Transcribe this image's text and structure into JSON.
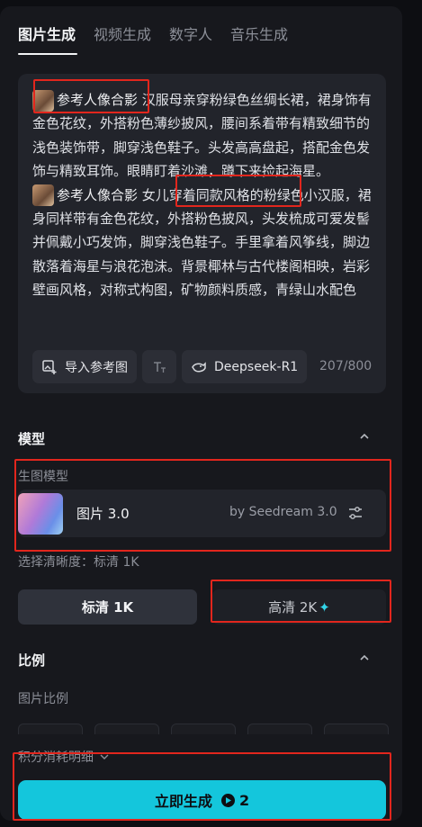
{
  "tabs": [
    {
      "label": "图片生成",
      "active": true
    },
    {
      "label": "视频生成",
      "active": false
    },
    {
      "label": "数字人",
      "active": false
    },
    {
      "label": "音乐生成",
      "active": false
    }
  ],
  "prompt": {
    "chip_label": "参考人像合影",
    "segment_1": " 汉服母亲穿粉绿色丝绸长裙，裙身饰有金色花纹，外搭粉色薄纱披风，腰间系着带有精致细节的浅色装饰带，脚穿浅色鞋子。头发高高盘起，搭配金色发饰与精致耳饰。眼睛盯着沙滩，蹲下来捡起海星。",
    "segment_2": " 女儿穿着同款风格的粉绿色小汉服，裙身同样带有金色花纹，外搭粉色披风，头发梳成可爱发髻并佩戴小巧发饰，脚穿浅色鞋子。手里拿着风筝线，脚边散落着海星与浪花泡沫。背景椰林与古代楼阁相映，岩彩壁画风格，对称式构图，矿物颜料质感，青绿山水配色"
  },
  "tools": {
    "import_ref": "导入参考图",
    "text_tool_icon": "text-format-icon",
    "deepseek": "Deepseek-R1",
    "counter": "207/800"
  },
  "model_section": {
    "title": "模型",
    "sub_label": "生图模型",
    "model_name": "图片 3.0",
    "model_by": "by Seedream 3.0",
    "resolution_label": "选择清晰度：标清 1K",
    "res_sd": "标清 1K",
    "res_hd": "高清 2K",
    "res_hd_icon": "sparkle-icon"
  },
  "ratio_section": {
    "title": "比例",
    "sub_label": "图片比例"
  },
  "credits": {
    "label": "积分消耗明细"
  },
  "generate": {
    "label": "立即生成",
    "cost": "2"
  },
  "colors": {
    "accent": "#14c6dc",
    "annotation": "#e2261d",
    "panel": "#17181d"
  }
}
